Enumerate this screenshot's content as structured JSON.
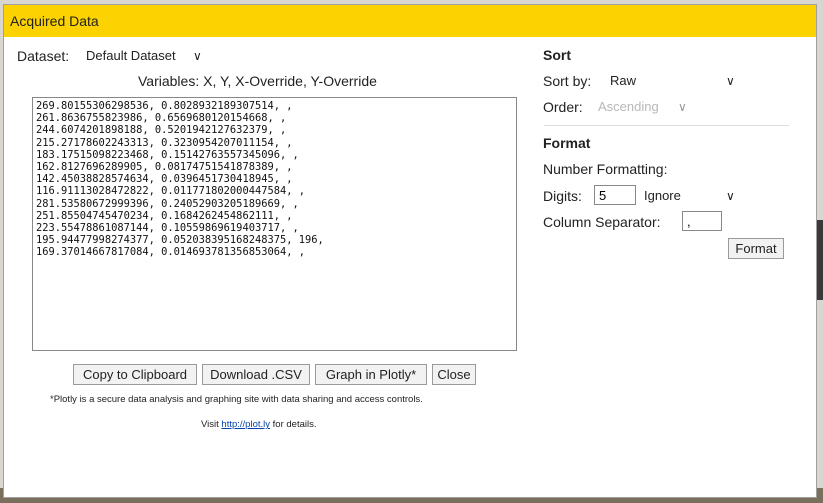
{
  "window": {
    "title": "Acquired Data"
  },
  "dataset": {
    "label": "Dataset:",
    "selected": "Default Dataset"
  },
  "variables": {
    "text": "Variables: X, Y, X-Override, Y-Override"
  },
  "data_rows": [
    "269.80155306298536, 0.8028932189307514, ,",
    "261.8636755823986, 0.6569680120154668, ,",
    "244.6074201898188, 0.5201942127632379, ,",
    "215.27178602243313, 0.3230954207011154, ,",
    "183.17515098223468, 0.15142763557345096, ,",
    "162.8127696289905, 0.08174751541878389, ,",
    "142.45038828574634, 0.0396451730418945, ,",
    "116.91113028472822, 0.011771802000447584, ,",
    "281.53580672999396, 0.24052903205189669, ,",
    "251.85504745470234, 0.1684262454862111, ,",
    "223.55478861087144, 0.10559869619403717, ,",
    "195.94477998274377, 0.052038395168248375, 196,",
    "169.37014667817084, 0.014693781356853064, ,"
  ],
  "buttons": {
    "copy": "Copy to Clipboard",
    "download": "Download .CSV",
    "plotly": "Graph in Plotly*",
    "close": "Close"
  },
  "notes": {
    "plotly_disclaimer": "*Plotly is a secure data analysis and graphing site with data sharing and access controls.",
    "visit_prefix": "Visit ",
    "visit_link": "http://plot.ly",
    "visit_suffix": " for details."
  },
  "sort": {
    "heading": "Sort",
    "sort_by_label": "Sort by:",
    "sort_by_value": "Raw",
    "order_label": "Order:",
    "order_value": "Ascending"
  },
  "format": {
    "heading": "Format",
    "number_formatting_label": "Number Formatting:",
    "digits_label": "Digits:",
    "digits_value": "5",
    "digits_mode": "Ignore",
    "column_separator_label": "Column Separator:",
    "column_separator_value": ",",
    "format_button": "Format"
  },
  "colors": {
    "titlebar": "#fcd200",
    "link": "#0645ad"
  },
  "icons": [
    "chevron-down-icon"
  ]
}
